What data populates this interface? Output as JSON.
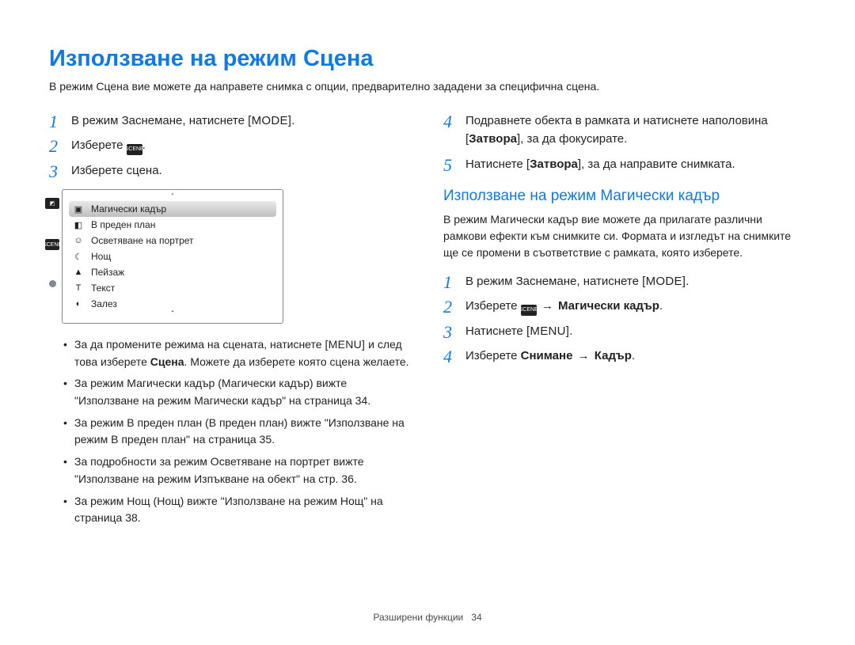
{
  "title": "Използване на режим Сцена",
  "intro": "В режим Сцена вие можете да направете снимка с опции, предварително зададени за специфична сцена.",
  "ui_tokens": {
    "mode": "MODE",
    "menu": "MENU",
    "scene_chip": "SCENE",
    "arrow": "→"
  },
  "left": {
    "steps": [
      {
        "pre": "В режим Заснемане, натиснете ",
        "token": "mode",
        "post": "."
      },
      {
        "pre": "Изберете ",
        "token": "scene_chip",
        "post": "."
      },
      {
        "pre": "Изберете сцена."
      }
    ],
    "screenshot": {
      "items": [
        {
          "icon": "magic-frame-icon",
          "glyph": "▣",
          "label": "Магически кадър",
          "selected": true
        },
        {
          "icon": "foreground-icon",
          "glyph": "◧",
          "label": "В преден план"
        },
        {
          "icon": "beauty-icon",
          "glyph": "☺",
          "label": "Осветяване на портрет"
        },
        {
          "icon": "night-icon",
          "glyph": "☾",
          "label": "Нощ"
        },
        {
          "icon": "landscape-icon",
          "glyph": "▲",
          "label": "Пейзаж"
        },
        {
          "icon": "text-icon",
          "glyph": "T",
          "label": "Текст"
        },
        {
          "icon": "sunset-icon",
          "glyph": "◐",
          "label": "Залез"
        }
      ]
    },
    "bullets": [
      {
        "segments": [
          {
            "text": "За да промените режима на сцената, натиснете "
          },
          {
            "token": "menu"
          },
          {
            "text": " и след това изберете "
          },
          {
            "text": "Сцена",
            "bold": true
          },
          {
            "text": ". Можете да изберете която сцена желаете."
          }
        ]
      },
      {
        "segments": [
          {
            "text": "За режим Магически кадър (Магически кадър) вижте \"Използване на режим Магически кадър\" на страница 34."
          }
        ]
      },
      {
        "segments": [
          {
            "text": "За режим В преден план (В преден план) вижте \"Използване на режим В преден план\" на страница 35."
          }
        ]
      },
      {
        "segments": [
          {
            "text": "За подробности за режим Осветяване на портрет вижте \"Използване на режим Изпъкване на обект\" на стр. 36."
          }
        ]
      },
      {
        "segments": [
          {
            "text": "За режим Нощ (Нощ) вижте \"Използване на режим Нощ\" на страница 38."
          }
        ]
      }
    ]
  },
  "right": {
    "steps_top": [
      {
        "segments": [
          {
            "text": "Подравнете обекта в рамката и натиснете наполовина ["
          },
          {
            "text": "Затвора",
            "bold": true
          },
          {
            "text": "], за да фокусирате."
          }
        ]
      },
      {
        "segments": [
          {
            "text": "Натиснете ["
          },
          {
            "text": "Затвора",
            "bold": true
          },
          {
            "text": "], за да направите снимката."
          }
        ]
      }
    ],
    "steps_top_start": 4,
    "subheading": "Използване на режим Магически кадър",
    "subdesc": "В режим Магически кадър вие можете да прилагате различни рамкови ефекти към снимките си. Формата и изгледът на снимките ще се промени в съответствие с рамката, която изберете.",
    "steps_bottom": [
      {
        "segments": [
          {
            "text": "В режим Заснемане, натиснете "
          },
          {
            "token": "mode"
          },
          {
            "text": "."
          }
        ]
      },
      {
        "segments": [
          {
            "text": "Изберете "
          },
          {
            "token": "scene_chip"
          },
          {
            "text": " "
          },
          {
            "token": "arrow"
          },
          {
            "text": " "
          },
          {
            "text": "Магически кадър",
            "bold": true
          },
          {
            "text": "."
          }
        ]
      },
      {
        "segments": [
          {
            "text": "Натиснете "
          },
          {
            "token": "menu"
          },
          {
            "text": "."
          }
        ]
      },
      {
        "segments": [
          {
            "text": "Изберете "
          },
          {
            "text": "Снимане",
            "bold": true
          },
          {
            "text": " "
          },
          {
            "token": "arrow"
          },
          {
            "text": " "
          },
          {
            "text": "Кадър",
            "bold": true
          },
          {
            "text": "."
          }
        ]
      }
    ]
  },
  "footer": {
    "section": "Разширени функции",
    "page": "34"
  }
}
